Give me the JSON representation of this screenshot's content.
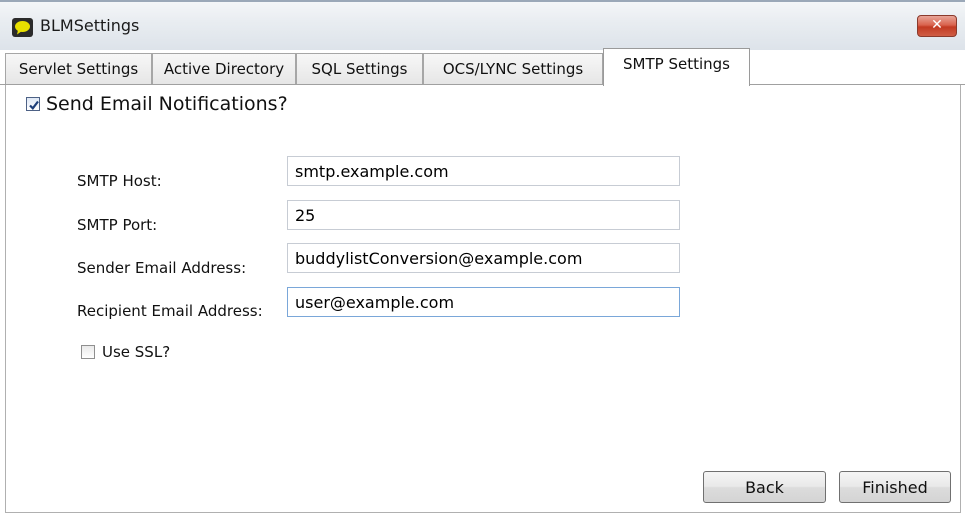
{
  "window": {
    "title": "BLMSettings",
    "close_glyph": "✕"
  },
  "tabs": [
    {
      "label": "Servlet Settings",
      "active": false
    },
    {
      "label": "Active Directory",
      "active": false
    },
    {
      "label": "SQL Settings",
      "active": false
    },
    {
      "label": "OCS/LYNC Settings",
      "active": false
    },
    {
      "label": "SMTP Settings",
      "active": true
    }
  ],
  "smtp": {
    "send_notifications_label": "Send Email Notifications?",
    "send_notifications_checked": true,
    "host_label": "SMTP Host:",
    "host_value": "smtp.example.com",
    "port_label": "SMTP Port:",
    "port_value": "25",
    "sender_label": "Sender Email Address:",
    "sender_value": "buddylistConversion@example.com",
    "recipient_label": "Recipient Email Address:",
    "recipient_value": "user@example.com",
    "ssl_label": "Use SSL?",
    "ssl_checked": false
  },
  "buttons": {
    "back": "Back",
    "finished": "Finished"
  },
  "colors": {
    "close_button": "#c23a22",
    "focus_border": "#7aa7d9",
    "checkbox_check": "#1e3f7a"
  },
  "icons": {
    "app": "speech-bubble-icon",
    "close": "close-icon"
  }
}
